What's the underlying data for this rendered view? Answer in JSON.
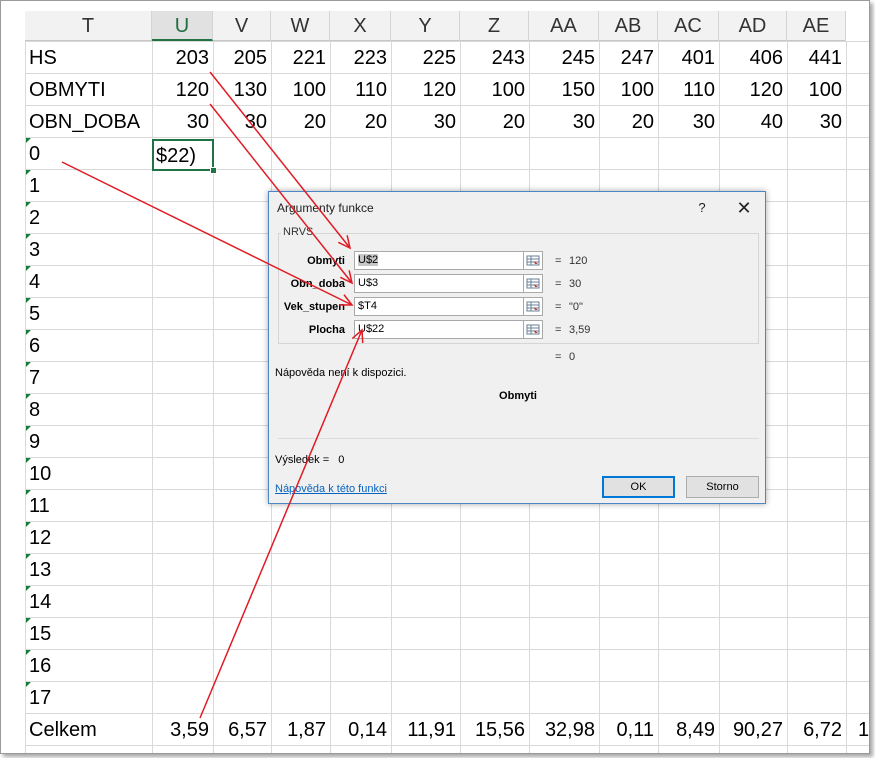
{
  "columns": [
    "T",
    "U",
    "V",
    "W",
    "X",
    "Y",
    "Z",
    "AA",
    "AB",
    "AC",
    "AD",
    "AE"
  ],
  "selected_column": "U",
  "rows": [
    {
      "label": "HS",
      "values": [
        "203",
        "205",
        "221",
        "223",
        "225",
        "243",
        "245",
        "247",
        "401",
        "406",
        "441"
      ]
    },
    {
      "label": "OBMYTI",
      "values": [
        "120",
        "130",
        "100",
        "110",
        "120",
        "100",
        "150",
        "100",
        "110",
        "120",
        "100"
      ]
    },
    {
      "label": "OBN_DOBA",
      "values": [
        "30",
        "30",
        "20",
        "20",
        "30",
        "20",
        "30",
        "20",
        "30",
        "40",
        "30"
      ]
    }
  ],
  "number_rows": [
    "0",
    "1",
    "2",
    "3",
    "4",
    "5",
    "6",
    "7",
    "8",
    "9",
    "10",
    "11",
    "12",
    "13",
    "14",
    "15",
    "16",
    "17"
  ],
  "active_cell_text": "$22)",
  "totals": {
    "label": "Celkem",
    "values": [
      "3,59",
      "6,57",
      "1,87",
      "0,14",
      "11,91",
      "15,56",
      "32,98",
      "0,11",
      "8,49",
      "90,27",
      "6,72"
    ],
    "overflow": "1"
  },
  "dialog": {
    "title": "Argumenty funkce",
    "help_icon": "?",
    "close_icon": "✕",
    "function_name": "NRVS",
    "args": [
      {
        "label": "Obmyti",
        "value": "U$2",
        "result": "120"
      },
      {
        "label": "Obn_doba",
        "value": "U$3",
        "result": "30"
      },
      {
        "label": "Vek_stupen",
        "value": "$T4",
        "result": "\"0\""
      },
      {
        "label": "Plocha",
        "value": "U$22",
        "result": "3,59"
      }
    ],
    "eq": "=",
    "function_result": "0",
    "help_text": "Nápověda není k dispozici.",
    "current_arg": "Obmyti",
    "result_label": "Výsledek =",
    "result_value": "0",
    "help_link": "Nápověda k této funkci",
    "ok_label": "OK",
    "cancel_label": "Storno"
  },
  "colors": {
    "annotation_arrow": "#e01b24",
    "selection": "#217346",
    "link": "#0563c1"
  }
}
